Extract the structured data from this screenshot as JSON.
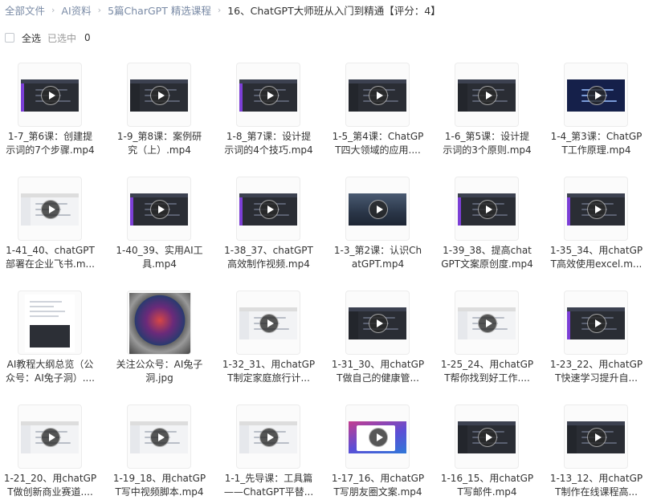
{
  "breadcrumb": [
    "全部文件",
    "AI资料",
    "5篇CharGPT 精选课程",
    "16、ChatGPT大师班从入门到精通【评分：4】"
  ],
  "selection": {
    "select_all": "全选",
    "selected_label": "已选中",
    "selected_count": "0"
  },
  "files": [
    {
      "line1": "1-7_第6课：创建提",
      "line2": "示词的7个步骤.mp4",
      "thumb": "video-dark-purple"
    },
    {
      "line1": "1-9_第8课：案例研",
      "line2": "究（上）.mp4",
      "thumb": "video-dark"
    },
    {
      "line1": "1-8_第7课：设计提",
      "line2": "示词的4个技巧.mp4",
      "thumb": "video-dark-purple"
    },
    {
      "line1": "1-5_第4课：ChatGP",
      "line2": "T四大领域的应用....",
      "thumb": "video-dark"
    },
    {
      "line1": "1-6_第5课：设计提",
      "line2": "示词的3个原则.mp4",
      "thumb": "video-dark"
    },
    {
      "line1": "1-4_第3课：ChatGP",
      "line2": "T工作原理.mp4",
      "thumb": "video-blue"
    },
    {
      "line1": "1-41_40、chatGPT",
      "line2": "部署在企业飞书.m...",
      "thumb": "video-light"
    },
    {
      "line1": "1-40_39、实用AI工",
      "line2": "具.mp4",
      "thumb": "video-dark-purple"
    },
    {
      "line1": "1-38_37、chatGPT",
      "line2": "高效制作视频.mp4",
      "thumb": "video-dark-purple"
    },
    {
      "line1": "1-3_第2课：认识Ch",
      "line2": "atGPT.mp4",
      "thumb": "video-city"
    },
    {
      "line1": "1-39_38、提高chat",
      "line2": "GPT文案原创度.mp4",
      "thumb": "video-dark-purple"
    },
    {
      "line1": "1-35_34、用chatGP",
      "line2": "T高效使用excel.m...",
      "thumb": "video-dark-purple"
    },
    {
      "line1": "AI教程大纲总览（公",
      "line2": "众号：AI兔子洞）....",
      "thumb": "document"
    },
    {
      "line1": "关注公众号：AI兔子",
      "line2": "洞.jpg",
      "thumb": "image-poster"
    },
    {
      "line1": "1-32_31、用chatGP",
      "line2": "T制定家庭旅行计...",
      "thumb": "video-light"
    },
    {
      "line1": "1-31_30、用chatGP",
      "line2": "T做自己的健康管...",
      "thumb": "video-dark"
    },
    {
      "line1": "1-25_24、用chatGP",
      "line2": "T帮你找到好工作....",
      "thumb": "video-light"
    },
    {
      "line1": "1-23_22、用chatGP",
      "line2": "T快速学习提升自...",
      "thumb": "video-dark-purple"
    },
    {
      "line1": "1-21_20、用chatGP",
      "line2": "T做创新商业赛道....",
      "thumb": "video-light"
    },
    {
      "line1": "1-19_18、用chatGP",
      "line2": "T写中视频脚本.mp4",
      "thumb": "video-light"
    },
    {
      "line1": "1-1_先导课：工具篇",
      "line2": "——ChatGPT平替...",
      "thumb": "video-light"
    },
    {
      "line1": "1-17_16、用chatGP",
      "line2": "T写朋友圈文案.mp4",
      "thumb": "video-mac"
    },
    {
      "line1": "1-16_15、用chatGP",
      "line2": "T写邮件.mp4",
      "thumb": "video-dark"
    },
    {
      "line1": "1-13_12、用chatGP",
      "line2": "T制作在线课程高...",
      "thumb": "video-dark"
    }
  ]
}
